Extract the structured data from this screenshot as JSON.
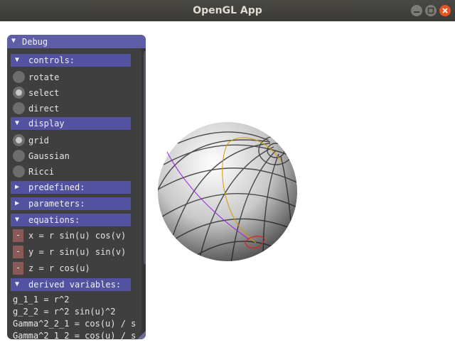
{
  "window": {
    "title": "OpenGL App"
  },
  "panel": {
    "title": "Debug",
    "sections": {
      "controls": "controls:",
      "display": "display",
      "predefined": "predefined:",
      "parameters": "parameters:",
      "equations": "equations:",
      "derived": "derived variables:"
    },
    "controls": [
      {
        "label": "rotate",
        "selected": false
      },
      {
        "label": "select",
        "selected": true
      },
      {
        "label": "direct",
        "selected": false
      }
    ],
    "display": [
      {
        "label": "grid",
        "selected": true
      },
      {
        "label": "Gaussian",
        "selected": false
      },
      {
        "label": "Ricci",
        "selected": false
      }
    ],
    "equations": [
      {
        "button": "-",
        "text": "x = r sin(u) cos(v)"
      },
      {
        "button": "-",
        "text": "y = r sin(u) sin(v)"
      },
      {
        "button": "-",
        "text": "z = r cos(u)"
      }
    ],
    "derived": [
      "g_1_1 = r^2",
      "g_2_2 = r^2 sin(u)^2",
      "Gamma^2_2_1 = cos(u) / s",
      "Gamma^2_1_2 = cos(u) / s"
    ]
  },
  "colors": {
    "panel_title": "#5e5ea8",
    "header": "#5252a0",
    "geodesic_orange": "#d99a00",
    "geodesic_purple": "#9b22e6",
    "marker_red": "#e02020"
  }
}
